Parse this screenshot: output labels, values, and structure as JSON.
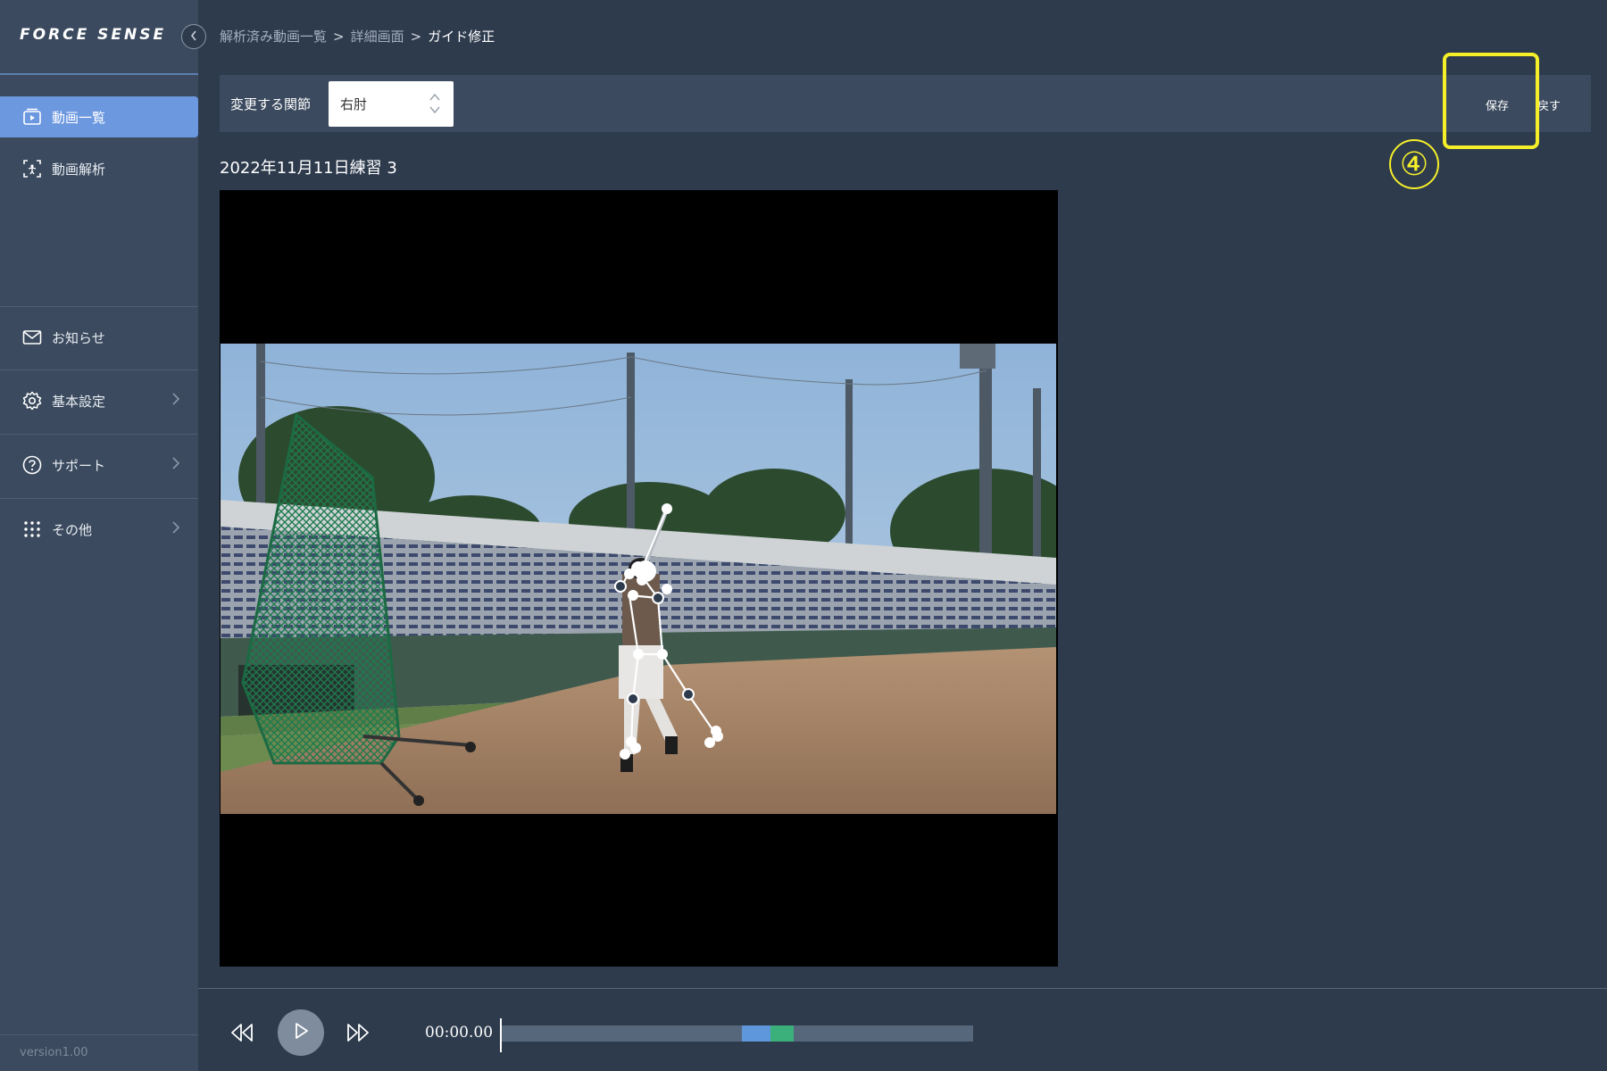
{
  "app": {
    "logo": "FORCE SENSE",
    "version": "version1.00"
  },
  "sidebar": {
    "items": [
      {
        "label": "動画一覧",
        "icon": "video-list-icon",
        "active": true
      },
      {
        "label": "動画解析",
        "icon": "video-analysis-icon",
        "active": false
      },
      {
        "label": "お知らせ",
        "icon": "mail-icon",
        "active": false
      },
      {
        "label": "基本設定",
        "icon": "gear-icon",
        "active": false,
        "submenu": true
      },
      {
        "label": "サポート",
        "icon": "help-icon",
        "active": false,
        "submenu": true
      },
      {
        "label": "その他",
        "icon": "grid-icon",
        "active": false,
        "submenu": true
      }
    ]
  },
  "breadcrumb": {
    "items": [
      "解析済み動画一覧",
      "詳細画面",
      "ガイド修正"
    ],
    "separator": ">"
  },
  "toolbar": {
    "joint_label": "変更する関節",
    "joint_value": "右肘",
    "save_label": "保存",
    "back_label": "戻す"
  },
  "annotation": {
    "step": "④",
    "color": "#f5ef2a"
  },
  "video": {
    "title": "2022年11月11日練習 3"
  },
  "player": {
    "timecode": "00:00.00",
    "segments": [
      {
        "color": "#5f97dd",
        "start": 0.51,
        "end": 0.57
      },
      {
        "color": "#3cb07a",
        "start": 0.57,
        "end": 0.62
      }
    ]
  },
  "colors": {
    "accent": "#6c98e0",
    "background": "#2e3b4d",
    "panel": "#3b4a5e"
  }
}
